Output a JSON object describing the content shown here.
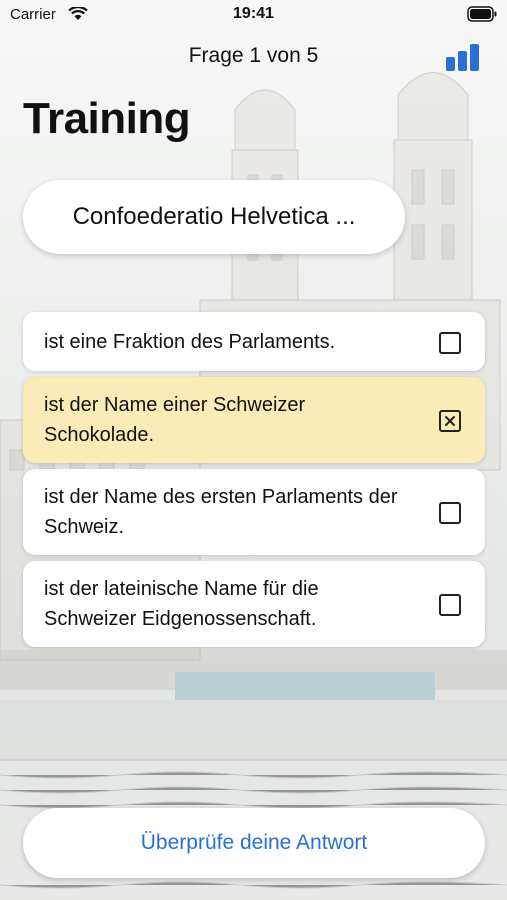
{
  "status_bar": {
    "carrier": "Carrier",
    "time": "19:41",
    "wifi_icon": "wifi-icon",
    "battery_icon": "battery-icon"
  },
  "nav": {
    "progress_text": "Frage 1 von 5",
    "stats_icon": "bar-chart-icon"
  },
  "page_title": "Training",
  "question": "Confoederatio Helvetica ...",
  "answers": [
    {
      "text": "ist eine Fraktion des Parlaments.",
      "checked": false
    },
    {
      "text": "ist der Name einer Schweizer Schokolade.",
      "checked": true
    },
    {
      "text": "ist der Name des ersten Parlaments der Schweiz.",
      "checked": false
    },
    {
      "text": "ist der lateinische Name für die Schweizer Eidgenossenschaft.",
      "checked": false
    }
  ],
  "check_button_label": "Überprüfe deine Antwort",
  "colors": {
    "accent": "#2a6fd3",
    "selected_answer_bg": "#fbebb6",
    "card_bg": "#ffffff"
  }
}
